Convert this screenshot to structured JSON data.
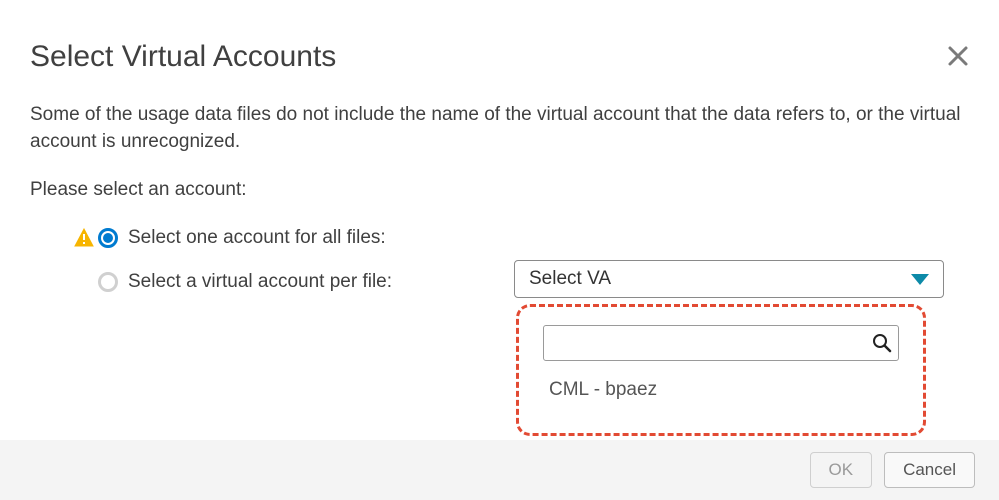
{
  "title": "Select Virtual Accounts",
  "description": "Some of the usage data files do not include the name of the virtual account that the data refers to, or the virtual account is unrecognized.",
  "prompt": "Please select an account:",
  "options": {
    "all_files": "Select one account for all files:",
    "per_file": "Select a virtual account per file:"
  },
  "select": {
    "placeholder": "Select VA"
  },
  "dropdown": {
    "search_value": "",
    "items": [
      "CML - bpaez"
    ]
  },
  "buttons": {
    "ok": "OK",
    "cancel": "Cancel"
  }
}
